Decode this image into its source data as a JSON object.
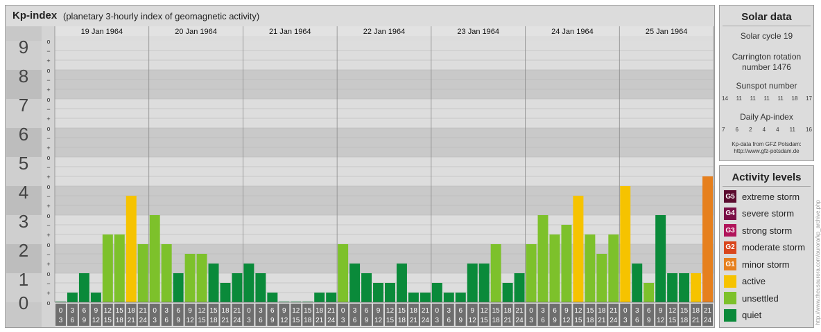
{
  "header": {
    "title": "Kp-index",
    "subtitle": "(planetary 3-hourly index of geomagnetic activity)"
  },
  "chart_data": {
    "type": "bar",
    "ylim": [
      0,
      9
    ],
    "y_major_labels": [
      "0",
      "1",
      "2",
      "3",
      "4",
      "5",
      "6",
      "7",
      "8",
      "9"
    ],
    "minor_tick_labels": [
      "o",
      "+",
      "−"
    ],
    "days": [
      "19 Jan 1964",
      "20 Jan 1964",
      "21 Jan 1964",
      "22 Jan 1964",
      "23 Jan 1964",
      "24 Jan 1964",
      "25 Jan 1964"
    ],
    "interval_start_hours": [
      "0",
      "3",
      "6",
      "9",
      "12",
      "15",
      "18",
      "21"
    ],
    "interval_end_hours": [
      "3",
      "6",
      "9",
      "12",
      "15",
      "18",
      "21",
      "24"
    ],
    "values": [
      [
        0.0,
        0.333,
        1.0,
        0.333,
        2.333,
        2.333,
        3.667,
        2.0
      ],
      [
        3.0,
        2.0,
        1.0,
        1.667,
        1.667,
        1.333,
        0.667,
        1.0
      ],
      [
        1.333,
        1.0,
        0.333,
        0.0,
        0.0,
        0.0,
        0.333,
        0.333
      ],
      [
        2.0,
        1.333,
        1.0,
        0.667,
        0.667,
        1.333,
        0.333,
        0.333
      ],
      [
        0.667,
        0.333,
        0.333,
        1.333,
        1.333,
        2.0,
        0.667,
        1.0
      ],
      [
        2.0,
        3.0,
        2.333,
        2.667,
        3.667,
        2.333,
        1.667,
        2.333
      ],
      [
        4.0,
        1.333,
        0.667,
        3.0,
        1.0,
        1.0,
        1.0,
        4.333,
        4.667
      ]
    ],
    "value_ranges": [
      {
        "min": 0,
        "max": 4,
        "level": "quiet"
      },
      {
        "min": 4,
        "max": 5,
        "level": "active"
      },
      {
        "min": 5,
        "max": 6,
        "level": "minor storm"
      }
    ],
    "level_colors": {
      "quiet": "#0a8a3a",
      "unsettled": "#7dc12b",
      "active": "#f6c300",
      "minor storm": "#e6801e"
    },
    "bar_levels": [
      [
        "quiet",
        "quiet",
        "quiet",
        "quiet",
        "unsettled",
        "unsettled",
        "active",
        "unsettled"
      ],
      [
        "unsettled",
        "unsettled",
        "quiet",
        "unsettled",
        "unsettled",
        "quiet",
        "quiet",
        "quiet"
      ],
      [
        "quiet",
        "quiet",
        "quiet",
        "quiet",
        "quiet",
        "quiet",
        "quiet",
        "quiet"
      ],
      [
        "unsettled",
        "quiet",
        "quiet",
        "quiet",
        "quiet",
        "quiet",
        "quiet",
        "quiet"
      ],
      [
        "quiet",
        "quiet",
        "quiet",
        "quiet",
        "quiet",
        "unsettled",
        "quiet",
        "quiet"
      ],
      [
        "unsettled",
        "unsettled",
        "unsettled",
        "unsettled",
        "active",
        "unsettled",
        "unsettled",
        "unsettled"
      ],
      [
        "active",
        "quiet",
        "unsettled",
        "quiet",
        "quiet",
        "quiet",
        "active",
        "minor storm"
      ]
    ]
  },
  "solar_data": {
    "title": "Solar data",
    "solar_cycle": "Solar cycle 19",
    "carrington_line1": "Carrington rotation",
    "carrington_line2": "number 1476",
    "sunspot_label": "Sunspot number",
    "sunspot_values": [
      "14",
      "11",
      "11",
      "11",
      "11",
      "18",
      "17"
    ],
    "ap_label": "Daily Ap-index",
    "ap_values": [
      "7",
      "6",
      "2",
      "4",
      "4",
      "11",
      "16"
    ],
    "credit_line1": "Kp-data from GFZ Potsdam:",
    "credit_line2": "http://www.gfz-potsdam.de"
  },
  "activity_levels": {
    "title": "Activity levels",
    "items": [
      {
        "badge": "G5",
        "label": "extreme storm",
        "color": "#5a0a2e"
      },
      {
        "badge": "G4",
        "label": "severe storm",
        "color": "#7a0e46"
      },
      {
        "badge": "G3",
        "label": "strong storm",
        "color": "#b0145a"
      },
      {
        "badge": "G2",
        "label": "moderate storm",
        "color": "#d9461c"
      },
      {
        "badge": "G1",
        "label": "minor storm",
        "color": "#e6801e"
      },
      {
        "badge": "",
        "label": "active",
        "color": "#f6c300"
      },
      {
        "badge": "",
        "label": "unsettled",
        "color": "#7dc12b"
      },
      {
        "badge": "",
        "label": "quiet",
        "color": "#0a8a3a"
      }
    ]
  },
  "side_credit": "http://www.theusaurora.com/aurora/kp_archive.php"
}
